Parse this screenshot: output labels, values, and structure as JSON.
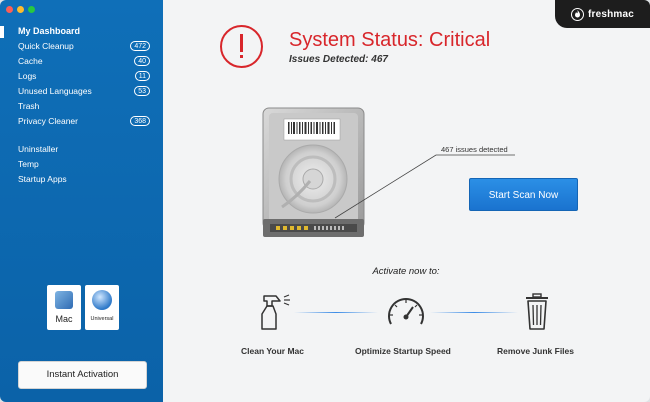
{
  "sidebar": {
    "items": [
      {
        "label": "My Dashboard",
        "badge": ""
      },
      {
        "label": "Quick Cleanup",
        "badge": "472"
      },
      {
        "label": "Cache",
        "badge": "40"
      },
      {
        "label": "Logs",
        "badge": "11"
      },
      {
        "label": "Unused Languages",
        "badge": "53"
      },
      {
        "label": "Trash",
        "badge": ""
      },
      {
        "label": "Privacy Cleaner",
        "badge": "368"
      }
    ],
    "tools": [
      {
        "label": "Uninstaller"
      },
      {
        "label": "Temp"
      },
      {
        "label": "Startup Apps"
      }
    ],
    "tiles": [
      {
        "label": "Mac"
      },
      {
        "label": "Universal"
      }
    ],
    "activation_button": "Instant Activation"
  },
  "brand": {
    "name": "freshmac",
    "icon": "flame-icon"
  },
  "status": {
    "title": "System Status: Critical",
    "subtitle": "Issues Detected: 467",
    "issues_label": "467 issues detected",
    "color": "#d8262b"
  },
  "scan_button": "Start Scan Now",
  "activate_prompt": "Activate now to:",
  "features": [
    {
      "label": "Clean Your Mac",
      "icon": "spray-bottle-icon"
    },
    {
      "label": "Optimize Startup Speed",
      "icon": "speedometer-icon"
    },
    {
      "label": "Remove Junk Files",
      "icon": "trash-bin-icon"
    }
  ],
  "colors": {
    "sidebar": "#0f6fb8",
    "accent_button": "#1a73cf",
    "critical": "#d8262b"
  }
}
